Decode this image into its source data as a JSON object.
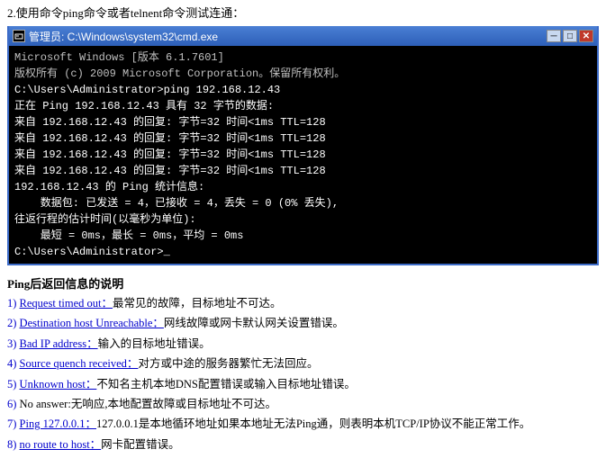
{
  "header": {
    "instruction": "2.使用命令ping命令或者telnent命令测试连通："
  },
  "cmd": {
    "titlebar": {
      "title": "管理员: C:\\Windows\\system32\\cmd.exe",
      "min": "─",
      "max": "□",
      "close": "✕"
    },
    "lines": [
      "Microsoft Windows [版本 6.1.7601]",
      "版权所有 (c) 2009 Microsoft Corporation。保留所有权利。",
      "",
      "C:\\Users\\Administrator>ping 192.168.12.43",
      "",
      "正在 Ping 192.168.12.43 具有 32 字节的数据:",
      "来自 192.168.12.43 的回复: 字节=32 时间<1ms TTL=128",
      "来自 192.168.12.43 的回复: 字节=32 时间<1ms TTL=128",
      "来自 192.168.12.43 的回复: 字节=32 时间<1ms TTL=128",
      "来自 192.168.12.43 的回复: 字节=32 时间<1ms TTL=128",
      "",
      "192.168.12.43 的 Ping 统计信息:",
      "    数据包: 已发送 = 4，已接收 = 4，丢失 = 0 (0% 丢失),",
      "往返行程的估计时间(以毫秒为单位):",
      "    最短 = 0ms，最长 = 0ms，平均 = 0ms",
      "",
      "C:\\Users\\Administrator>_"
    ]
  },
  "ping_info": {
    "title": "Ping后返回信息的说明",
    "items": [
      {
        "id": "1",
        "text": "Request timed out：最常见的故障，目标地址不可达。"
      },
      {
        "id": "2",
        "text": "Destination host Unreachable：网线故障或网卡默认网关设置错误。"
      },
      {
        "id": "3",
        "text": "Bad IP address：输入的目标地址错误。"
      },
      {
        "id": "4",
        "text": "Source quench received：对方或中途的服务器繁忙无法回应。"
      },
      {
        "id": "5",
        "text": "Unknown host：不知名主机本地DNS配置错误或输入目标地址错误。"
      },
      {
        "id": "6",
        "text": "No answer:无响应,本地配置故障或目标地址不可达。"
      },
      {
        "id": "7",
        "text": "Ping 127.0.0.1：127.0.0.1是本地循环地址如果本地址无法Ping通，则表明本机TCP/IP协议不能正常工作。"
      },
      {
        "id": "8",
        "text": "no route to host：网卡配置错误。"
      }
    ]
  }
}
